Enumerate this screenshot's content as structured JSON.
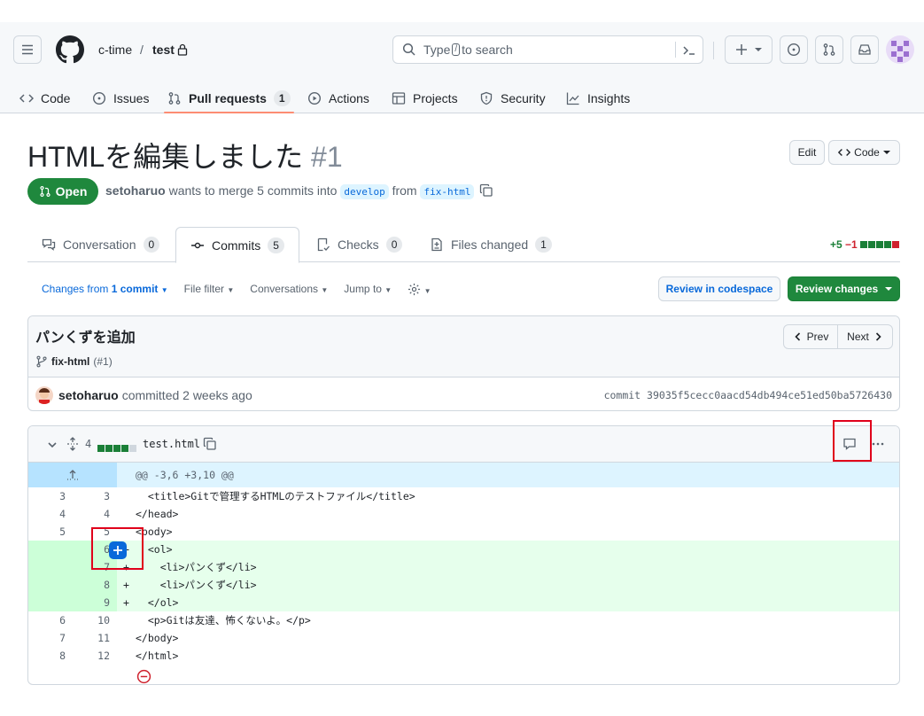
{
  "repo": {
    "owner": "c-time",
    "name": "test"
  },
  "search": {
    "placeholder_pre": "Type",
    "placeholder_key": "/",
    "placeholder_post": "to search"
  },
  "nav": [
    {
      "label": "Code"
    },
    {
      "label": "Issues"
    },
    {
      "label": "Pull requests",
      "count": "1"
    },
    {
      "label": "Actions"
    },
    {
      "label": "Projects"
    },
    {
      "label": "Security"
    },
    {
      "label": "Insights"
    }
  ],
  "pr": {
    "title": "HTMLを編集しました",
    "number": "#1",
    "state": "Open",
    "author": "setoharuo",
    "merge_text": "wants to merge 5 commits into",
    "base": "develop",
    "from_text": "from",
    "head": "fix-html",
    "edit_label": "Edit",
    "code_label": "Code"
  },
  "tabs": [
    {
      "label": "Conversation",
      "count": "0"
    },
    {
      "label": "Commits",
      "count": "5"
    },
    {
      "label": "Checks",
      "count": "0"
    },
    {
      "label": "Files changed",
      "count": "1"
    }
  ],
  "diffstat": {
    "added": "+5",
    "removed": "−1"
  },
  "toolbar": {
    "changes_from": "Changes from",
    "changes_commit": "1 commit",
    "file_filter": "File filter",
    "conversations": "Conversations",
    "jump_to": "Jump to",
    "review_codespace": "Review in codespace",
    "review_changes": "Review changes"
  },
  "commit": {
    "message": "パンくずを追加",
    "branch": "fix-html",
    "branch_ref": "(#1)",
    "prev": "Prev",
    "next": "Next",
    "author": "setoharuo",
    "committed": "committed 2 weeks ago",
    "sha_label": "commit",
    "sha": "39035f5cecc0aacd54db494ce51ed50ba5726430"
  },
  "file": {
    "changes": "4",
    "name": "test.html",
    "hunk": "@@ -3,6 +3,10 @@",
    "lines": [
      {
        "old": "3",
        "new": "3",
        "sign": "",
        "code": "  <title>Gitで管理するHTMLのテストファイル</title>",
        "type": "ctx"
      },
      {
        "old": "4",
        "new": "4",
        "sign": "",
        "code": "</head>",
        "type": "ctx"
      },
      {
        "old": "5",
        "new": "5",
        "sign": "",
        "code": "<body>",
        "type": "ctx"
      },
      {
        "old": "",
        "new": "6",
        "sign": "+",
        "code": "  <ol>",
        "type": "add"
      },
      {
        "old": "",
        "new": "7",
        "sign": "+",
        "code": "    <li>パンくず</li>",
        "type": "add"
      },
      {
        "old": "",
        "new": "8",
        "sign": "+",
        "code": "    <li>パンくず</li>",
        "type": "add"
      },
      {
        "old": "",
        "new": "9",
        "sign": "+",
        "code": "  </ol>",
        "type": "add"
      },
      {
        "old": "6",
        "new": "10",
        "sign": "",
        "code": "  <p>Gitは友達、怖くないよ。</p>",
        "type": "ctx"
      },
      {
        "old": "7",
        "new": "11",
        "sign": "",
        "code": "</body>",
        "type": "ctx"
      },
      {
        "old": "8",
        "new": "12",
        "sign": "",
        "code": "</html>",
        "type": "ctx"
      }
    ]
  },
  "colors": {
    "open_green": "#1f883d",
    "accent_blue": "#0969da",
    "add_bg": "#e6ffec",
    "highlight_red": "#e0001b"
  }
}
